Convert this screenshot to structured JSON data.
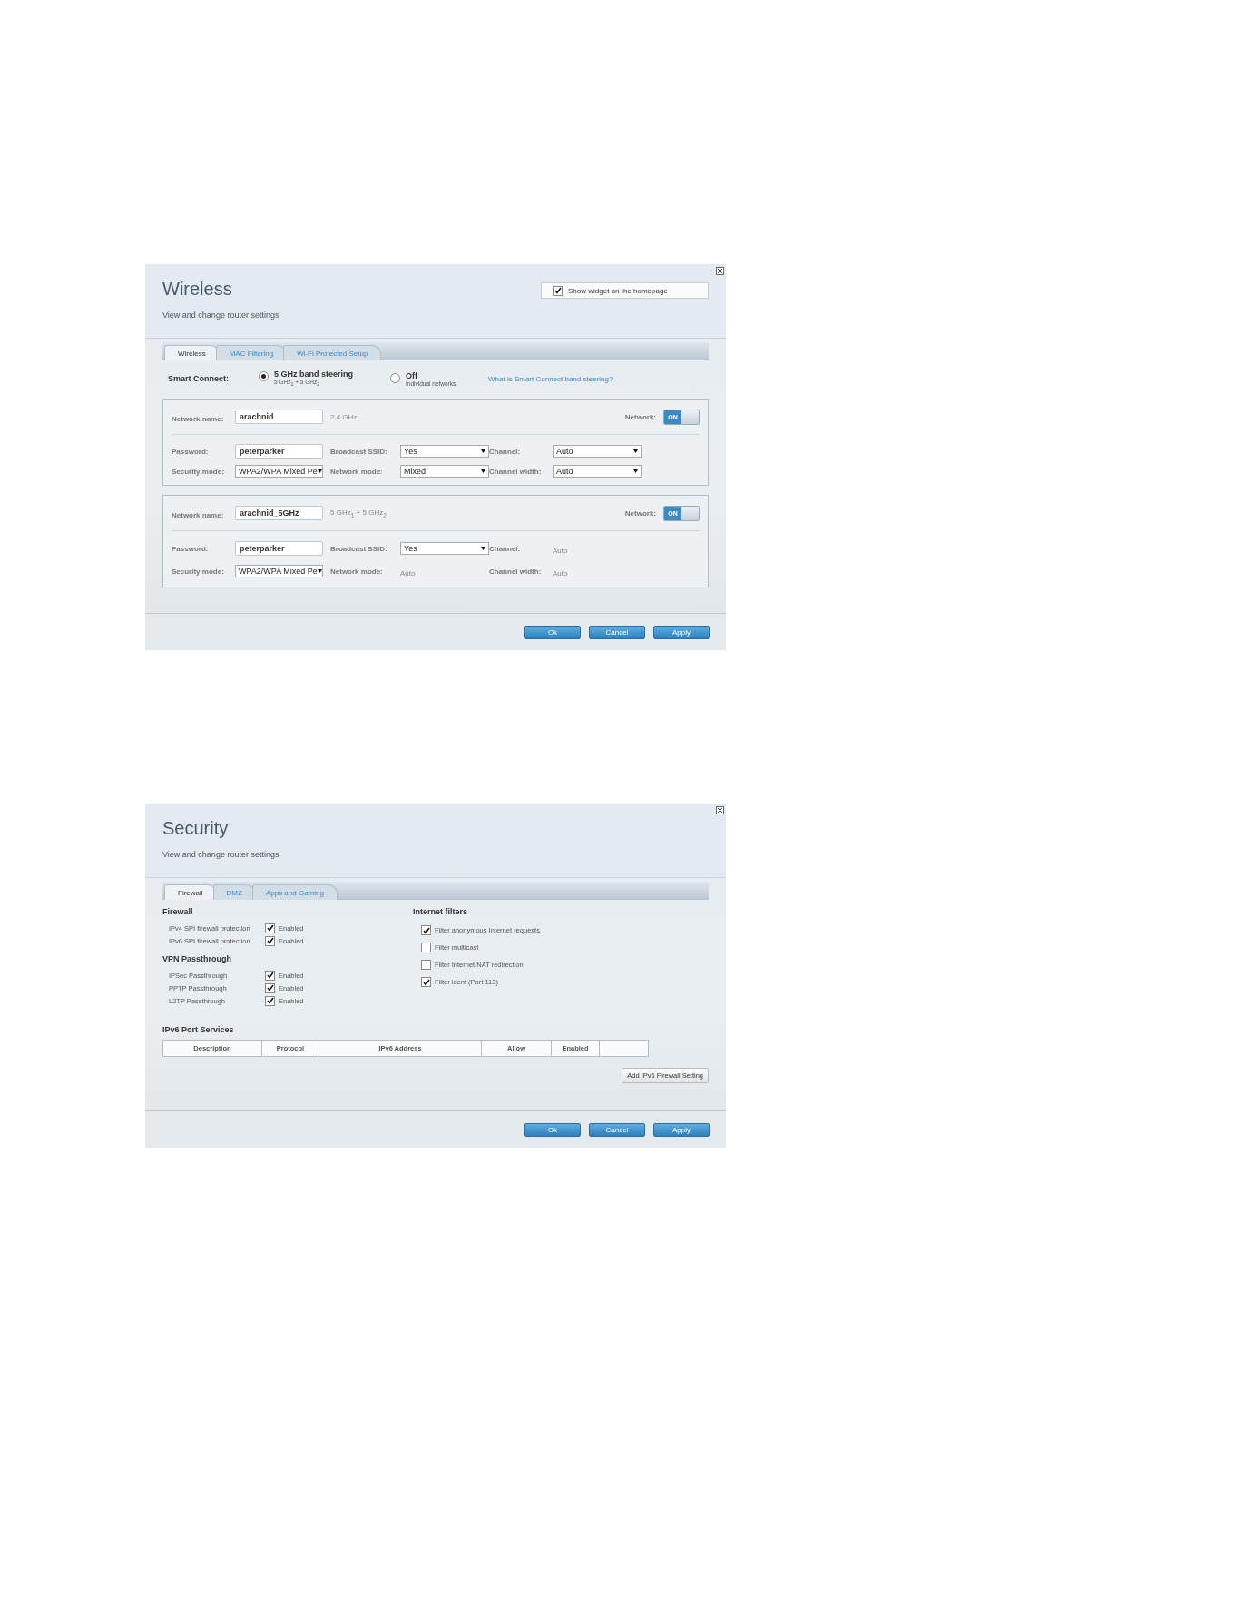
{
  "dialogs": [
    {
      "kind": "wireless",
      "title": "Wireless",
      "subtitle": "View and change router settings",
      "widget": {
        "label": "Show widget on the homepage",
        "checked": true
      },
      "tabs": [
        {
          "label": "Wireless",
          "selected": true
        },
        {
          "label": "MAC Filtering",
          "selected": false
        },
        {
          "label": "Wi-Fi Protected Setup",
          "selected": false
        }
      ],
      "smart_connect": {
        "label": "Smart Connect:",
        "options": [
          {
            "label": "5 GHz band steering",
            "sublabel": "5 GHz$_{1}$ + 5 GHz$_{2}$",
            "selected": true
          },
          {
            "label": "Off",
            "sublabel": "Individual networks",
            "selected": false
          }
        ],
        "help_link": "What is Smart Connect band steering?"
      },
      "networks": [
        {
          "name_label": "Network name:",
          "name": "arachnid",
          "band": "2.4 GHz",
          "network_label": "Network:",
          "on": true,
          "toggle_text": "ON",
          "fields": [
            {
              "label": "Password:",
              "kind": "input",
              "value": "peterparker"
            },
            {
              "label": "Broadcast SSID:",
              "kind": "select",
              "value": "Yes"
            },
            {
              "label": "Channel:",
              "kind": "select",
              "value": "Auto"
            },
            {
              "label": "Security mode:",
              "kind": "select",
              "value": "WPA2/WPA Mixed Pe"
            },
            {
              "label": "Network mode:",
              "kind": "select",
              "value": "Mixed"
            },
            {
              "label": "Channel width:",
              "kind": "select",
              "value": "Auto"
            }
          ]
        },
        {
          "name_label": "Network name:",
          "name": "arachnid_5GHz",
          "band": "5 GHz$_{1}$ + 5 GHz$_{2}$",
          "network_label": "Network:",
          "on": true,
          "toggle_text": "ON",
          "fields": [
            {
              "label": "Password:",
              "kind": "input",
              "value": "peterparker"
            },
            {
              "label": "Broadcast SSID:",
              "kind": "select",
              "value": "Yes"
            },
            {
              "label": "Channel:",
              "kind": "text",
              "value": "Auto"
            },
            {
              "label": "Security mode:",
              "kind": "select",
              "value": "WPA2/WPA Mixed Pe"
            },
            {
              "label": "Network mode:",
              "kind": "text",
              "value": "Auto"
            },
            {
              "label": "Channel width:",
              "kind": "text",
              "value": "Auto"
            }
          ]
        }
      ],
      "buttons": [
        "Ok",
        "Cancel",
        "Apply"
      ]
    },
    {
      "kind": "security",
      "title": "Security",
      "subtitle": "View and change router settings",
      "tabs": [
        {
          "label": "Firewall",
          "selected": true
        },
        {
          "label": "DMZ",
          "selected": false
        },
        {
          "label": "Apps and Gaming",
          "selected": false
        }
      ],
      "left_sections": [
        {
          "heading": "Firewall",
          "items": [
            {
              "label": "IPv4 SPI firewall protection",
              "checked": true,
              "check_label": "Enabled"
            },
            {
              "label": "IPv6 SPI firewall protection",
              "checked": true,
              "check_label": "Enabled"
            }
          ]
        },
        {
          "heading": "VPN Passthrough",
          "items": [
            {
              "label": "IPSec Passthrough",
              "checked": true,
              "check_label": "Enabled"
            },
            {
              "label": "PPTP Passthrough",
              "checked": true,
              "check_label": "Enabled"
            },
            {
              "label": "L2TP Passthrough",
              "checked": true,
              "check_label": "Enabled"
            }
          ]
        }
      ],
      "filters": {
        "heading": "Internet filters",
        "items": [
          {
            "label": "Filter anonymous Internet requests",
            "checked": true
          },
          {
            "label": "Filter multicast",
            "checked": false
          },
          {
            "label": "Filter Internet NAT redirection",
            "checked": false
          },
          {
            "label": "Filter ident (Port 113)",
            "checked": true
          }
        ]
      },
      "table": {
        "heading": "IPv6 Port Services",
        "columns": [
          "Description",
          "Protocol",
          "IPv6 Address",
          "Allow",
          "Enabled"
        ]
      },
      "add_button": "Add IPv6 Firewall Setting",
      "buttons": [
        "Ok",
        "Cancel",
        "Apply"
      ]
    }
  ]
}
